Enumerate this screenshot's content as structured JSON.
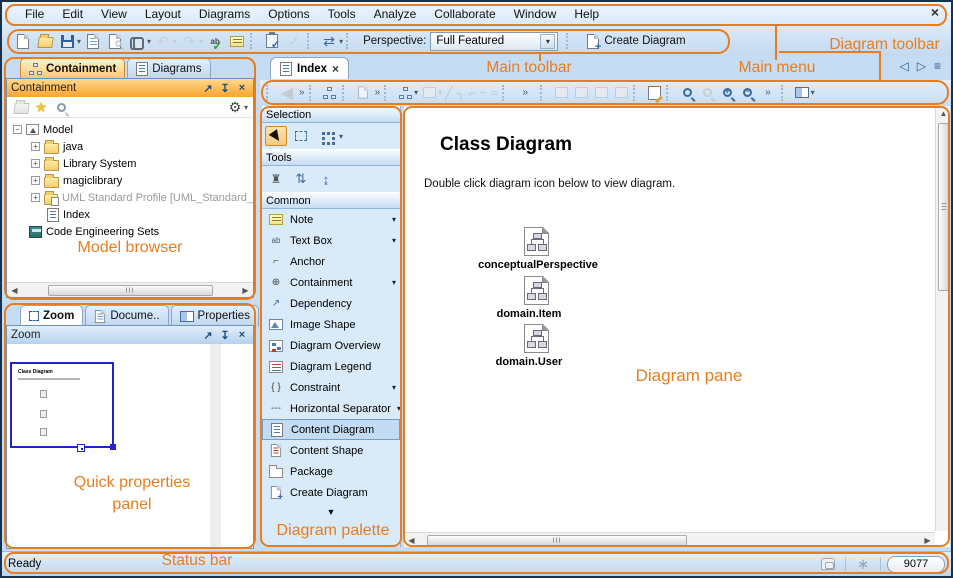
{
  "window": {
    "app_kind": "MagicDraw UML modeling tool (annotated tutorial screenshot)"
  },
  "menu": {
    "items": [
      "File",
      "Edit",
      "View",
      "Layout",
      "Diagrams",
      "Options",
      "Tools",
      "Analyze",
      "Collaborate",
      "Window",
      "Help"
    ]
  },
  "toolbar": {
    "perspective_label": "Perspective:",
    "perspective_value": "Full Featured",
    "create_diagram_label": "Create Diagram"
  },
  "icons": {
    "close": "×",
    "chevron": "»",
    "dropdown": "▾",
    "star": "★",
    "gear": "⚙",
    "undo": "↶",
    "redo": "↷",
    "exchange": "⇄",
    "check": "✓",
    "abc": "ab",
    "back": "◀",
    "scroll_left": "◀",
    "scroll_right": "▶",
    "scroll_up": "▲",
    "scroll_down": "▼",
    "nav_prev": "◁",
    "nav_next": "▷",
    "tab_list": "≡",
    "restore": "↗",
    "pin": "↧",
    "line1": "╱",
    "line2": "┐",
    "line3": "⌐",
    "line4": "~",
    "line5": "≈",
    "distribute_v": "⇅",
    "match_size": "↨",
    "stamp": "♜",
    "asterisk": "∗",
    "constraint": "{ }",
    "separator_dashes": "---",
    "anchor": "⌐",
    "containment_cross": "⊕",
    "dependency": "↗"
  },
  "annotations": {
    "diagram_toolbar": "Diagram toolbar",
    "main_toolbar": "Main toolbar",
    "main_menu": "Main menu",
    "model_browser": "Model browser",
    "quick_properties": "Quick properties panel",
    "diagram_palette": "Diagram palette",
    "diagram_pane": "Diagram pane",
    "status_bar": "Status bar"
  },
  "browser": {
    "tabs": [
      {
        "label": "Containment"
      },
      {
        "label": "Diagrams"
      }
    ],
    "header_title": "Containment",
    "tree": [
      {
        "label": "Model"
      },
      {
        "label": "java"
      },
      {
        "label": "Library System"
      },
      {
        "label": "magiclibrary"
      },
      {
        "label": "UML Standard Profile [UML_Standard_"
      },
      {
        "label": "Index"
      },
      {
        "label": "Code Engineering Sets"
      }
    ]
  },
  "quick_panel": {
    "tabs": [
      "Zoom",
      "Docume..",
      "Properties"
    ],
    "header_title": "Zoom",
    "preview_title": "Class Diagram"
  },
  "diagram_tab": {
    "label": "Index"
  },
  "palette": {
    "sections": {
      "selection": "Selection",
      "tools": "Tools",
      "common": "Common"
    },
    "items": [
      "Note",
      "Text Box",
      "Anchor",
      "Containment",
      "Dependency",
      "Image Shape",
      "Diagram Overview",
      "Diagram Legend",
      "Constraint",
      "Horizontal Separator",
      "Content Diagram",
      "Content Shape",
      "Package",
      "Create Diagram"
    ]
  },
  "canvas": {
    "title": "Class Diagram",
    "subtitle": "Double click diagram icon below to view diagram.",
    "icons": [
      {
        "label": "conceptualPerspective"
      },
      {
        "label": "domain.Item"
      },
      {
        "label": "domain.User"
      }
    ]
  },
  "status": {
    "ready": "Ready",
    "memory": "9077"
  }
}
